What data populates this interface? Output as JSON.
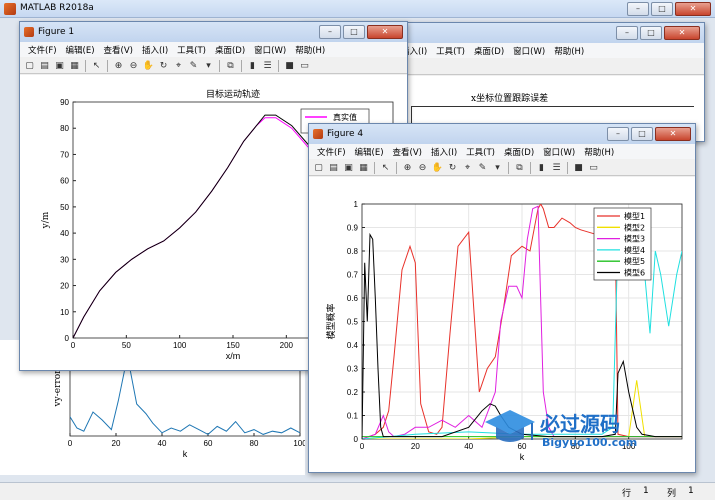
{
  "app": {
    "title": "MATLAB R2018a"
  },
  "menu": [
    "文件(F)",
    "编辑(E)",
    "查看(V)",
    "插入(I)",
    "工具(T)",
    "桌面(D)",
    "窗口(W)",
    "帮助(H)"
  ],
  "status": {
    "row_label": "行",
    "row_value": "1",
    "col_label": "列",
    "col_value": "1"
  },
  "fig1": {
    "title": "Figure 1",
    "chart_data": {
      "type": "line",
      "title": "目标运动轨迹",
      "xlabel": "x/m",
      "ylabel": "y/m",
      "xlim": [
        0,
        300
      ],
      "ylim": [
        0,
        90
      ],
      "xticks": [
        "0",
        "50",
        "100",
        "150",
        "200",
        "250"
      ],
      "yticks": [
        "0",
        "10",
        "20",
        "30",
        "40",
        "50",
        "60",
        "70",
        "80",
        "90"
      ],
      "legend": [
        "真实值"
      ],
      "series": [
        {
          "name": "真实值",
          "color": "#ff00ff",
          "x": [
            0,
            10,
            25,
            40,
            55,
            70,
            85,
            100,
            115,
            130,
            145,
            160,
            172,
            180,
            190,
            205,
            220,
            240,
            260,
            280,
            300
          ],
          "y": [
            0,
            8,
            18,
            25,
            30,
            34,
            37,
            42,
            48,
            56,
            65,
            75,
            81,
            84,
            84,
            80,
            73,
            65,
            58,
            53,
            49
          ]
        },
        {
          "name": "",
          "color": "#000000",
          "x": [
            0,
            10,
            25,
            40,
            55,
            70,
            85,
            100,
            115,
            130,
            145,
            160,
            172,
            180,
            190,
            205,
            220,
            240,
            260,
            280,
            300
          ],
          "y": [
            0,
            8,
            18,
            25,
            30,
            34,
            37,
            42,
            48,
            56,
            65,
            75,
            81,
            85,
            85,
            81,
            74,
            66,
            59,
            54,
            50
          ]
        }
      ]
    }
  },
  "fig_back": {
    "chart_data": {
      "type": "line",
      "title": "x坐标位置跟踪误差",
      "xlabel": "",
      "ylabel": "",
      "series": []
    }
  },
  "fig_vy": {
    "chart_data": {
      "type": "line",
      "title": "",
      "xlabel": "k",
      "ylabel": "vy-error",
      "xlim": [
        0,
        100
      ],
      "ylim": [
        0,
        6
      ],
      "xticks": [
        "0",
        "20",
        "40",
        "60",
        "80",
        "100"
      ],
      "series": [
        {
          "name": "",
          "color": "#1f77b4",
          "x": [
            0,
            3,
            6,
            10,
            14,
            18,
            21,
            25,
            29,
            33,
            36,
            40,
            44,
            48,
            52,
            56,
            60,
            64,
            68,
            72,
            76,
            80,
            84,
            88,
            92,
            96,
            100
          ],
          "y": [
            1.2,
            0.5,
            0.3,
            1.5,
            1.0,
            0.4,
            2.2,
            5.0,
            2.0,
            1.4,
            0.8,
            0.2,
            0.5,
            0.3,
            0.7,
            0.4,
            0.1,
            0.6,
            0.3,
            0.9,
            0.2,
            0.4,
            0.1,
            0.3,
            0.2,
            0.5,
            0.2
          ]
        }
      ]
    }
  },
  "fig4": {
    "title": "Figure 4",
    "chart_data": {
      "type": "line",
      "title": "",
      "xlabel": "k",
      "ylabel": "模型概率",
      "xlim": [
        0,
        120
      ],
      "ylim": [
        0,
        1
      ],
      "xticks": [
        "0",
        "20",
        "40",
        "60",
        "80",
        "100"
      ],
      "yticks": [
        "0",
        "0.1",
        "0.2",
        "0.3",
        "0.4",
        "0.5",
        "0.6",
        "0.7",
        "0.8",
        "0.9",
        "1"
      ],
      "series": [
        {
          "name": "模型1",
          "color": "#e8312a",
          "x": [
            0,
            5,
            8,
            10,
            12,
            15,
            18,
            20,
            22,
            25,
            28,
            30,
            33,
            36,
            40,
            44,
            47,
            50,
            53,
            56,
            60,
            63,
            66,
            67,
            68,
            70,
            72,
            75,
            78,
            80,
            82,
            85,
            88,
            90,
            92,
            94,
            95,
            96,
            100,
            105,
            110,
            115,
            120
          ],
          "y": [
            0,
            0.02,
            0.05,
            0.12,
            0.35,
            0.72,
            0.82,
            0.75,
            0.15,
            0.03,
            0.02,
            0.05,
            0.45,
            0.82,
            0.88,
            0.2,
            0.3,
            0.35,
            0.55,
            0.78,
            0.82,
            0.8,
            0.98,
            1,
            0.98,
            0.9,
            0.9,
            0.94,
            0.92,
            0.9,
            0.89,
            0.88,
            0.87,
            0.88,
            0.87,
            0.87,
            0.86,
            0.02,
            0.01,
            0.01,
            0.01,
            0.01,
            0.01
          ]
        },
        {
          "name": "模型2",
          "color": "#f0e000",
          "x": [
            0,
            20,
            40,
            60,
            80,
            95,
            100,
            103,
            106,
            110,
            120
          ],
          "y": [
            0,
            0,
            0,
            0.01,
            0.01,
            0.01,
            0.01,
            0.25,
            0.01,
            0.01,
            0.01
          ]
        },
        {
          "name": "模型3",
          "color": "#e020e0",
          "x": [
            0,
            5,
            8,
            10,
            12,
            16,
            20,
            25,
            30,
            35,
            40,
            45,
            50,
            52,
            55,
            58,
            60,
            62,
            64,
            66,
            68,
            70,
            72,
            75,
            80,
            90,
            100,
            110,
            120
          ],
          "y": [
            0,
            0.02,
            0.1,
            0.03,
            0.01,
            0.02,
            0.05,
            0.05,
            0.08,
            0.05,
            0.1,
            0.05,
            0.2,
            0.5,
            0.65,
            0.65,
            0.6,
            0.85,
            0.98,
            0.99,
            0.2,
            0.05,
            0.01,
            0.01,
            0.01,
            0.01,
            0.01,
            0.01,
            0.01
          ]
        },
        {
          "name": "模型4",
          "color": "#20e0e0",
          "x": [
            0,
            20,
            40,
            60,
            80,
            90,
            94,
            96,
            100,
            103,
            106,
            108,
            110,
            112,
            115,
            118,
            120
          ],
          "y": [
            0,
            0.02,
            0.03,
            0.02,
            0.02,
            0.02,
            0.05,
            0.85,
            0.8,
            0.82,
            0.7,
            0.45,
            0.8,
            0.7,
            0.48,
            0.7,
            0.8
          ]
        },
        {
          "name": "模型5",
          "color": "#20c020",
          "x": [
            0,
            20,
            40,
            60,
            80,
            100,
            120
          ],
          "y": [
            0.01,
            0.01,
            0.01,
            0.01,
            0.01,
            0.01,
            0.01
          ]
        },
        {
          "name": "模型6",
          "color": "#000000",
          "x": [
            0,
            1,
            2,
            3,
            4,
            5,
            6,
            7,
            8,
            10,
            20,
            30,
            40,
            45,
            48,
            50,
            52,
            55,
            60,
            70,
            80,
            90,
            95,
            96,
            98,
            100,
            103,
            105,
            110,
            120
          ],
          "y": [
            0,
            0.75,
            0.5,
            0.87,
            0.85,
            0.6,
            0.3,
            0.05,
            0.01,
            0.01,
            0.01,
            0.01,
            0.05,
            0.12,
            0.15,
            0.14,
            0.1,
            0.05,
            0.02,
            0.01,
            0.01,
            0.01,
            0.02,
            0.28,
            0.33,
            0.2,
            0.05,
            0.02,
            0.01,
            0.01
          ]
        }
      ]
    }
  },
  "watermark": {
    "title": "必过源码",
    "site": "Bigyuo100.com"
  }
}
